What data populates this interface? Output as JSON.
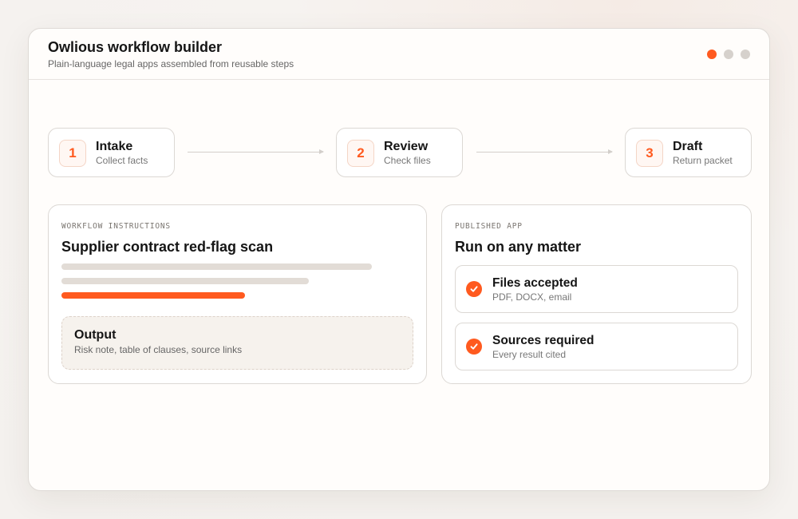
{
  "header": {
    "title": "Owlious workflow builder",
    "subtitle": "Plain-language legal apps assembled from reusable steps",
    "pager": {
      "count": 3,
      "active_index": 0
    }
  },
  "steps": [
    {
      "number": "1",
      "title": "Intake",
      "subtitle": "Collect facts"
    },
    {
      "number": "2",
      "title": "Review",
      "subtitle": "Check files"
    },
    {
      "number": "3",
      "title": "Draft",
      "subtitle": "Return packet"
    }
  ],
  "instructions": {
    "label": "WORKFLOW INSTRUCTIONS",
    "title": "Supplier contract red-flag scan",
    "output_title": "Output",
    "output_subtitle": "Risk note, table of clauses, source links"
  },
  "published": {
    "label": "PUBLISHED APP",
    "title": "Run on any matter",
    "features": [
      {
        "title": "Files accepted",
        "subtitle": "PDF, DOCX, email"
      },
      {
        "title": "Sources required",
        "subtitle": "Every result cited"
      }
    ]
  },
  "colors": {
    "accent": "#ff5a1f",
    "border": "#dcd8d4",
    "placeholder_bar": "#e2dcd6",
    "dot_inactive": "#d6d1cc"
  }
}
